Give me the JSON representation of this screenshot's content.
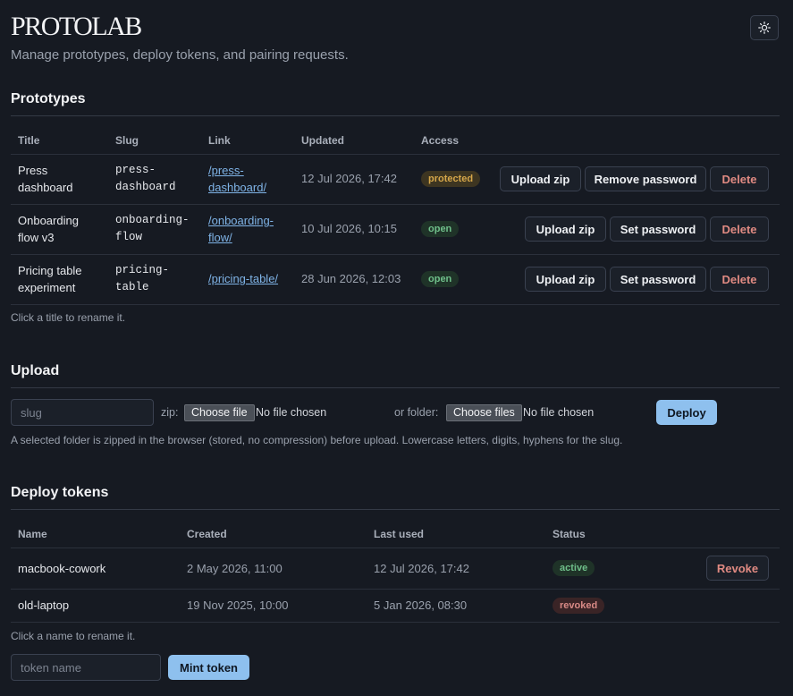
{
  "app": {
    "brand": "PROTOLAB",
    "tagline": "Manage prototypes, deploy tokens, and pairing requests.",
    "theme_icon": "sun-icon"
  },
  "prototypes": {
    "title": "Prototypes",
    "columns": [
      "Title",
      "Slug",
      "Link",
      "Updated",
      "Access"
    ],
    "rows": [
      {
        "title": [
          "Press",
          "dashboard"
        ],
        "slug": [
          "press-",
          "dashboard"
        ],
        "link": [
          "/press-",
          "dashboard/"
        ],
        "updated": "12 Jul 2026, 17:42",
        "access": "protected",
        "upload_label": "Upload zip",
        "password_label": "Remove password",
        "delete_label": "Delete"
      },
      {
        "title": [
          "Onboarding",
          "flow v3"
        ],
        "slug": [
          "onboarding-",
          "flow"
        ],
        "link": [
          "/onboarding-",
          "flow/"
        ],
        "updated": "10 Jul 2026, 10:15",
        "access": "open",
        "upload_label": "Upload zip",
        "password_label": "Set password",
        "delete_label": "Delete"
      },
      {
        "title": [
          "Pricing table",
          "experiment"
        ],
        "slug": [
          "pricing-",
          "table"
        ],
        "link": [
          "/pricing-table/"
        ],
        "updated": "28 Jun 2026, 12:03",
        "access": "open",
        "upload_label": "Upload zip",
        "password_label": "Set password",
        "delete_label": "Delete"
      }
    ],
    "hint": "Click a title to rename it."
  },
  "upload": {
    "title": "Upload",
    "slug_placeholder": "slug",
    "zip_label": "zip:",
    "choose_file_label": "Choose file",
    "no_file_text": "No file chosen",
    "folder_label": "or folder:",
    "choose_files_label": "Choose files",
    "no_files_text": "No file chosen",
    "deploy_label": "Deploy",
    "hint": "A selected folder is zipped in the browser (stored, no compression) before upload. Lowercase letters, digits, hyphens for the slug."
  },
  "tokens": {
    "title": "Deploy tokens",
    "columns": [
      "Name",
      "Created",
      "Last used",
      "Status"
    ],
    "rows": [
      {
        "name": "macbook-cowork",
        "created": "2 May 2026, 11:00",
        "last_used": "12 Jul 2026, 17:42",
        "status": "active",
        "revoke_label": "Revoke"
      },
      {
        "name": "old-laptop",
        "created": "19 Nov 2025, 10:00",
        "last_used": "5 Jan 2026, 08:30",
        "status": "revoked"
      }
    ],
    "hint": "Click a name to rename it.",
    "name_placeholder": "token name",
    "mint_label": "Mint token"
  },
  "colors": {
    "background": "#161a22",
    "accent": "#8ec0ee",
    "danger": "#e08a82",
    "protected": "#d6a74a",
    "open": "#6fbf8a"
  }
}
